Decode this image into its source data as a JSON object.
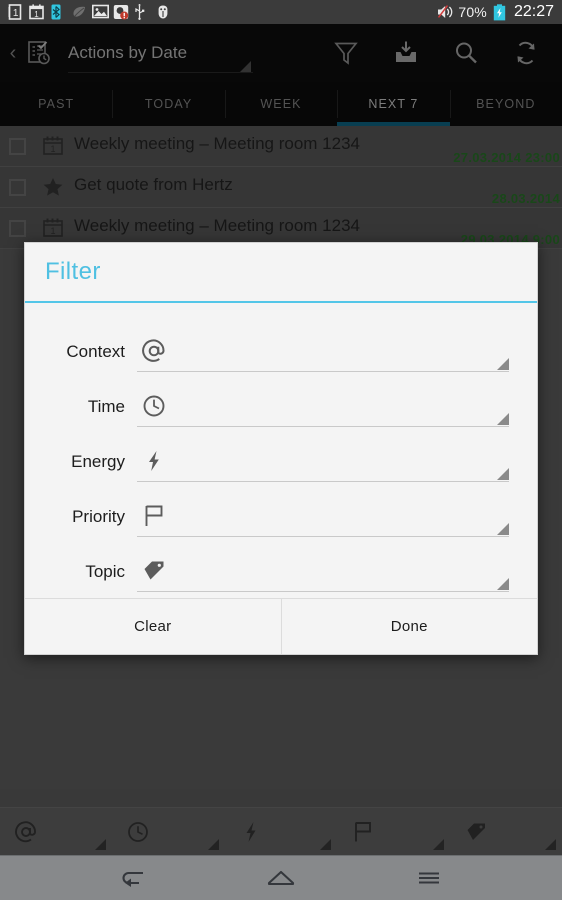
{
  "status_bar": {
    "icons": [
      "sim-card-1-icon",
      "calendar-icon",
      "bluetooth-icon",
      "leaf-icon",
      "gallery-image-icon",
      "storage-warning-icon",
      "usb-icon",
      "debug-bug-icon"
    ],
    "volume_icon": "volume-muted-icon",
    "battery_percent": "70%",
    "battery_icon": "battery-charging-icon",
    "clock": "22:27"
  },
  "action_bar": {
    "back_icon": "back-chevron-icon",
    "app_icon": "actions-list-clock-icon",
    "title": "Actions by Date",
    "spinner_icon": "spinner-triangle-icon",
    "actions": [
      {
        "name": "filter-button",
        "icon": "funnel-icon"
      },
      {
        "name": "inbox-button",
        "icon": "inbox-download-icon"
      },
      {
        "name": "search-button",
        "icon": "search-icon"
      },
      {
        "name": "sync-button",
        "icon": "refresh-sync-icon"
      }
    ]
  },
  "tabs": [
    {
      "label": "PAST",
      "active": false
    },
    {
      "label": "TODAY",
      "active": false
    },
    {
      "label": "WEEK",
      "active": false
    },
    {
      "label": "NEXT 7",
      "active": true
    },
    {
      "label": "BEYOND",
      "active": false
    }
  ],
  "tab_accent_color": "#0f6b8c",
  "list": [
    {
      "title": "Weekly meeting – Meeting room 1234",
      "date": "27.03.2014 23:00",
      "icon": "calendar-icon",
      "checked": false
    },
    {
      "title": "Get quote from Hertz",
      "date": "28.03.2014",
      "icon": "star-icon",
      "checked": false
    },
    {
      "title": "Weekly meeting – Meeting room 1234",
      "date": "29.03.2014 9:00",
      "icon": "calendar-icon",
      "checked": false
    }
  ],
  "list_date_color": "#2c7a2c",
  "dialog": {
    "title": "Filter",
    "title_color": "#4fc0e2",
    "fields": [
      {
        "label": "Context",
        "icon": "at-sign-icon",
        "value": ""
      },
      {
        "label": "Time",
        "icon": "clock-icon",
        "value": ""
      },
      {
        "label": "Energy",
        "icon": "lightning-icon",
        "value": ""
      },
      {
        "label": "Priority",
        "icon": "flag-icon",
        "value": ""
      },
      {
        "label": "Topic",
        "icon": "tag-icon",
        "value": ""
      }
    ],
    "clear_label": "Clear",
    "done_label": "Done"
  },
  "bottom_bar": {
    "spinners": [
      {
        "icon": "at-sign-icon",
        "name": "context-filter-spinner"
      },
      {
        "icon": "clock-icon",
        "name": "time-filter-spinner"
      },
      {
        "icon": "lightning-icon",
        "name": "energy-filter-spinner"
      },
      {
        "icon": "flag-icon",
        "name": "priority-filter-spinner"
      },
      {
        "icon": "tag-icon",
        "name": "topic-filter-spinner"
      }
    ]
  },
  "nav_bar": {
    "buttons": [
      {
        "name": "nav-back-button",
        "icon": "back-arrow-icon"
      },
      {
        "name": "nav-home-button",
        "icon": "home-icon"
      },
      {
        "name": "nav-recents-button",
        "icon": "recents-menu-icon"
      }
    ]
  }
}
